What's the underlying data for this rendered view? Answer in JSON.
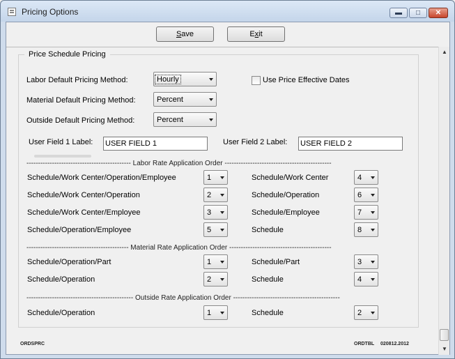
{
  "window": {
    "title": "Pricing Options"
  },
  "toolbar": {
    "save_label": "Save",
    "save_mnemonic": "S",
    "save_rest": "ave",
    "exit_label": "Exit",
    "exit_pre": "E",
    "exit_mnemonic": "x",
    "exit_rest": "it"
  },
  "group": {
    "legend": "Price Schedule Pricing"
  },
  "pricing": {
    "labor_label": "Labor Default Pricing Method:",
    "labor_value": "Hourly",
    "material_label": "Material Default Pricing Method:",
    "material_value": "Percent",
    "outside_label": "Outside Default Pricing Method:",
    "outside_value": "Percent",
    "effective_dates_label": "Use Price Effective Dates",
    "effective_dates_checked": false
  },
  "user_fields": {
    "field1_label": "User Field 1 Label:",
    "field1_value": "USER FIELD 1",
    "field2_label": "User Field 2 Label:",
    "field2_value": "USER FIELD 2"
  },
  "labor_order": {
    "heading": "--------------------------------------------- Labor Rate Application Order ----------------------------------------------",
    "left": [
      {
        "label": "Schedule/Work Center/Operation/Employee",
        "value": "1"
      },
      {
        "label": "Schedule/Work Center/Operation",
        "value": "2"
      },
      {
        "label": "Schedule/Work Center/Employee",
        "value": "3"
      },
      {
        "label": "Schedule/Operation/Employee",
        "value": "5"
      }
    ],
    "right": [
      {
        "label": "Schedule/Work Center",
        "value": "4"
      },
      {
        "label": "Schedule/Operation",
        "value": "6"
      },
      {
        "label": "Schedule/Employee",
        "value": "7"
      },
      {
        "label": "Schedule",
        "value": "8"
      }
    ]
  },
  "material_order": {
    "heading": "-------------------------------------------- Material Rate Application Order --------------------------------------------",
    "left": [
      {
        "label": "Schedule/Operation/Part",
        "value": "1"
      },
      {
        "label": "Schedule/Operation",
        "value": "2"
      }
    ],
    "right": [
      {
        "label": "Schedule/Part",
        "value": "3"
      },
      {
        "label": "Schedule",
        "value": "4"
      }
    ]
  },
  "outside_order": {
    "heading": "---------------------------------------------- Outside Rate Application Order ----------------------------------------------",
    "left": [
      {
        "label": "Schedule/Operation",
        "value": "1"
      }
    ],
    "right": [
      {
        "label": "Schedule",
        "value": "2"
      }
    ]
  },
  "footer": {
    "left_code": "ORDSPRC",
    "right_code": "ORDTBL",
    "version": "020812.2012"
  }
}
